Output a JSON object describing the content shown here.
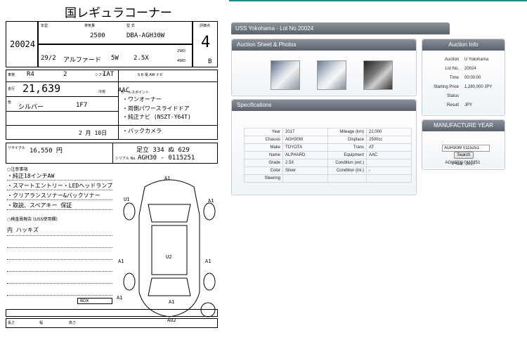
{
  "sheet": {
    "title": "国レギュラコーナー",
    "lot_no": "20024",
    "displacement": "2500",
    "model_code": "DBA-AGH30W",
    "grade_score": "4",
    "interior_score": "B",
    "year_reg": "29/2",
    "car_name": "アルファード",
    "doors": "5W",
    "grade": "2.5X",
    "year": "R4",
    "month": "2",
    "trans": "IAT",
    "mileage": "21,639",
    "ac": "AAC",
    "color": "シルバー",
    "color_code": "1F7",
    "seats": "8",
    "selling_points": [
      "・ワンオーナー",
      "・両側パワースライドドア",
      "・純正ナビ (NSZT-Y64T)",
      "・バックカメラ"
    ],
    "date": "2 月 10日",
    "recycle": "16,550 円",
    "plate": "足立 334 ぬ 629",
    "serial": "AGH30 - 0115251",
    "notes": [
      "・純正18インチAW",
      "・スマートエントリー・LEDヘッドランプ",
      "・クリアランスソナー&バックソナー",
      "・取説、スペアキー 保証"
    ],
    "inspector_label": "○検査員報告 (USS使用欄)",
    "inspector_note": "内 ハッキズ",
    "box_label": "BOX",
    "row_labels": [
      "長さ",
      "幅",
      "高さ"
    ],
    "marks": [
      "A1",
      "U1",
      "A1",
      "U2",
      "A1",
      "A1",
      "A1",
      "AU2",
      "A1"
    ]
  },
  "lot_bar": {
    "title": "USS Yokohama - Lot No.20024"
  },
  "sheet_panel": {
    "title": "Auction Sheet & Photos"
  },
  "auction_info": {
    "title": "Auction Info",
    "rows": [
      {
        "k": "Auction",
        "v": "U Yokohama"
      },
      {
        "k": "Lot No.",
        "v": "20024"
      },
      {
        "k": "Time",
        "v": "00:00:00"
      },
      {
        "k": "Starting Price",
        "v": "1,280,000 JPY"
      },
      {
        "k": "Status",
        "v": ""
      },
      {
        "k": "Result",
        "v": "JPY"
      }
    ]
  },
  "specs": {
    "title": "Specifications",
    "rows": [
      [
        "Year",
        "2017",
        "Mileage (km)",
        "22,000"
      ],
      [
        "Chassis",
        "AGH30W",
        "Displace",
        "2500cc"
      ],
      [
        "Make",
        "TOYOTA",
        "Trans",
        "AT"
      ],
      [
        "Name",
        "ALPHARD",
        "Equipment",
        "AAC"
      ],
      [
        "Grade",
        "2.5X",
        "Condition (ext.)",
        ""
      ],
      [
        "Color",
        "Silver",
        "Condition (int.)",
        "-"
      ],
      [
        "Steering",
        "",
        "",
        ""
      ]
    ]
  },
  "manufacture": {
    "title": "MANUFACTURE YEAR",
    "input_value": "AGH30W 0115251",
    "button": "Search",
    "result_year": "PYear: 2017",
    "result_chassis": "AGH30W 0115251"
  },
  "colors": {
    "panel_head": "#5b616b",
    "accent": "#1e8a86"
  }
}
